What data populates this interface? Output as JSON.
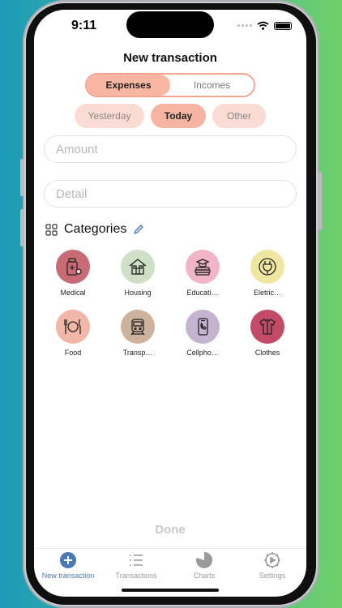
{
  "status_bar": {
    "time": "9:11"
  },
  "screen_title": "New transaction",
  "type_segment": {
    "options": [
      "Expenses",
      "Incomes"
    ],
    "selected": "Expenses"
  },
  "day_segment": {
    "options": [
      "Yesterday",
      "Today",
      "Other"
    ],
    "selected": "Today"
  },
  "amount_field": {
    "placeholder": "Amount",
    "value": ""
  },
  "detail_field": {
    "placeholder": "Detail",
    "value": ""
  },
  "categories": {
    "title": "Categories",
    "items": [
      {
        "label": "Medical",
        "icon": "medicine-bottle-icon",
        "color": "#c96b74"
      },
      {
        "label": "Housing",
        "icon": "house-icon",
        "color": "#cfe0c6"
      },
      {
        "label": "Educati…",
        "icon": "books-graduation-icon",
        "color": "#f1b6c6"
      },
      {
        "label": "Eletric…",
        "icon": "plug-icon",
        "color": "#efe6a2"
      },
      {
        "label": "Food",
        "icon": "plate-utensils-icon",
        "color": "#f2b7a7"
      },
      {
        "label": "Transp…",
        "icon": "train-icon",
        "color": "#cdb39e"
      },
      {
        "label": "Cellpho…",
        "icon": "smartphone-icon",
        "color": "#c4b4cf"
      },
      {
        "label": "Clothes",
        "icon": "clothes-icon",
        "color": "#c34b67"
      }
    ]
  },
  "done_label": "Done",
  "tab_bar": {
    "items": [
      {
        "label": "New transaction",
        "icon": "plus-circle-icon"
      },
      {
        "label": "Transactions",
        "icon": "list-icon"
      },
      {
        "label": "Charts",
        "icon": "pie-chart-icon"
      },
      {
        "label": "Settings",
        "icon": "gear-icon"
      }
    ],
    "active": "New transaction"
  },
  "colors": {
    "accent": "#f8b6a3",
    "tab_active": "#4a78b8"
  }
}
